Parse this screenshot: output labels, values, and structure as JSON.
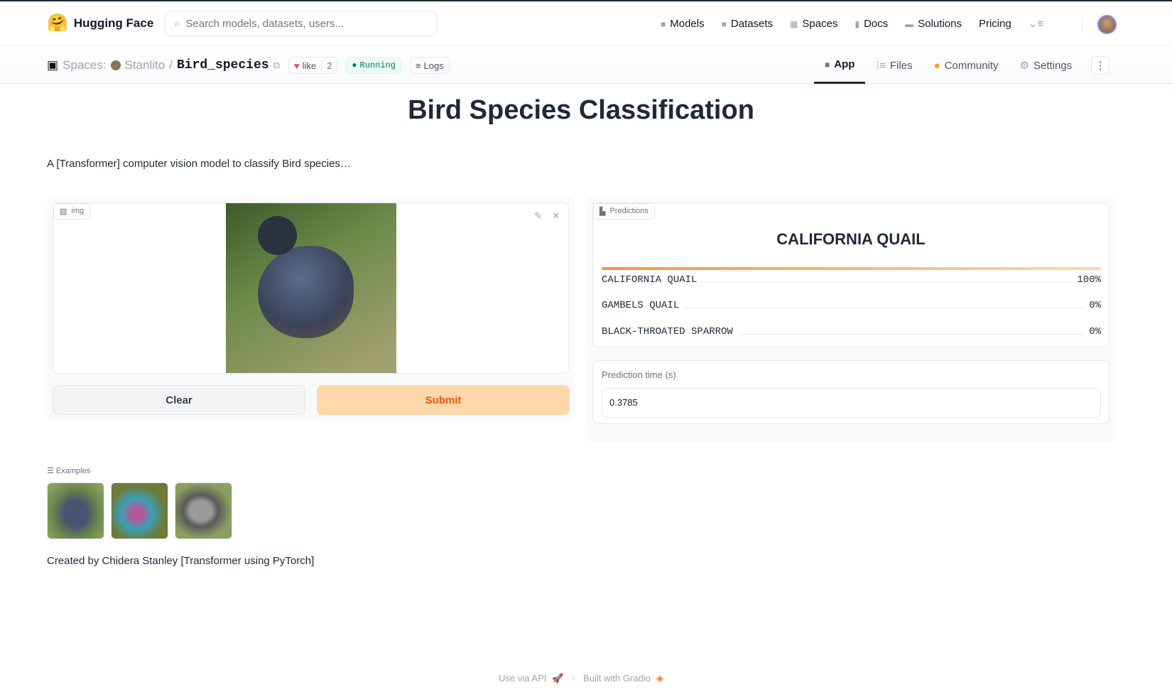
{
  "nav": {
    "brand": "Hugging Face",
    "search_placeholder": "Search models, datasets, users...",
    "menu": [
      {
        "label": "Models",
        "icon": "cube-icon"
      },
      {
        "label": "Datasets",
        "icon": "database-icon"
      },
      {
        "label": "Spaces",
        "icon": "grid-icon"
      },
      {
        "label": "Docs",
        "icon": "book-icon"
      },
      {
        "label": "Solutions",
        "icon": "briefcase-icon"
      },
      {
        "label": "Pricing"
      }
    ]
  },
  "space": {
    "prefix": "Spaces:",
    "owner": "Stanlito",
    "separator": "/",
    "name": "Bird_species",
    "like": "like",
    "likes": "2",
    "status": "Running",
    "logs": "Logs"
  },
  "tabs": {
    "app": "App",
    "files": "Files",
    "community": "Community",
    "settings": "Settings"
  },
  "page": {
    "title": "Bird Species Classification",
    "description": "A [Transformer] computer vision model to classify Bird species…",
    "created": "Created by Chidera Stanley [Transformer using PyTorch]"
  },
  "input": {
    "label": "img",
    "clear": "Clear",
    "submit": "Submit"
  },
  "predictions": {
    "label": "Predictions",
    "top": "CALIFORNIA QUAIL",
    "items": [
      {
        "name": "CALIFORNIA QUAIL",
        "value": "100%",
        "confidence": 1.0
      },
      {
        "name": "GAMBELS QUAIL",
        "value": "0%",
        "confidence": 0
      },
      {
        "name": "BLACK-THROATED SPARROW",
        "value": "0%",
        "confidence": 0
      }
    ]
  },
  "time": {
    "label": "Prediction time (s)",
    "value": "0.3785"
  },
  "examples": {
    "label": "Examples"
  },
  "footer": {
    "api": "Use via API",
    "dot": "·",
    "built": "Built with Gradio"
  },
  "colors": {
    "accent": "#f97316",
    "submit_bg": "#fed7aa",
    "running": "#047857"
  }
}
